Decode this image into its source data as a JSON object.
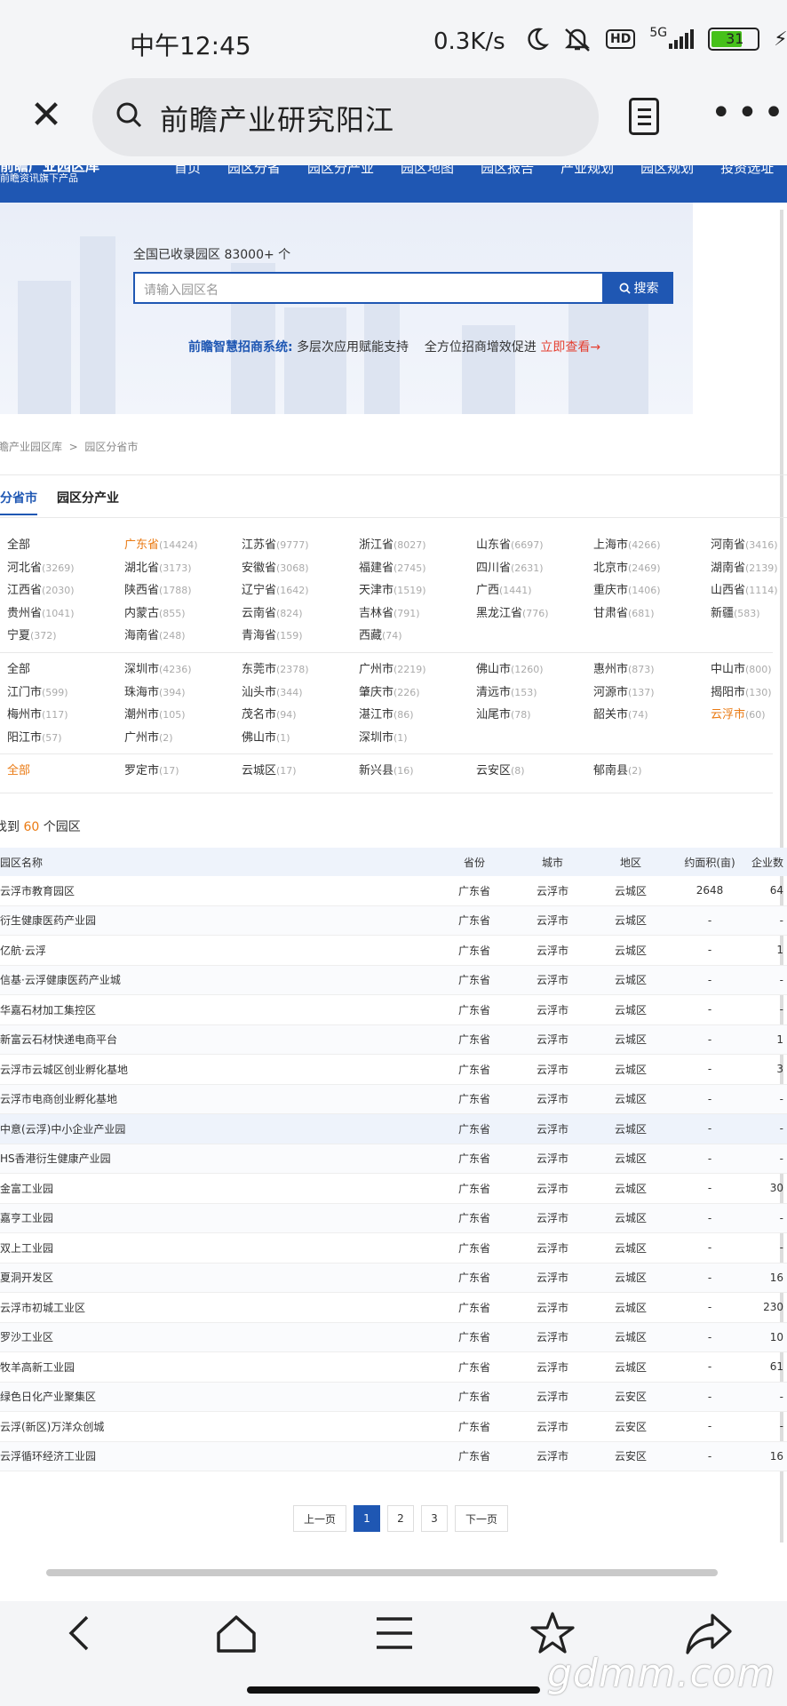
{
  "status": {
    "time": "中午12:45",
    "speed": "0.3K/s",
    "hd": "HD",
    "signal": "5G",
    "battery": "31"
  },
  "browser": {
    "query": "前瞻产业研究阳江"
  },
  "site": {
    "logo_line1": "前瞻产业园区库",
    "logo_line2": "前瞻资讯旗下产品",
    "menu": [
      "首页",
      "园区分省",
      "园区分产业",
      "园区地图",
      "园区报告",
      "产业规划",
      "园区规划",
      "投资选址"
    ],
    "hero": {
      "count": "全国已收录园区 83000+ 个",
      "placeholder": "请输入园区名",
      "search_label": "搜索",
      "promo_title": "前瞻智慧招商系统:",
      "promo_text": "多层次应用赋能支持    全方位招商增效促进",
      "promo_link": "立即查看→"
    },
    "breadcrumb": "前瞻产业园区库  >  园区分省市",
    "tabs": [
      "园区分省市",
      "园区分产业"
    ],
    "provinces": [
      {
        "name": "全部",
        "count": ""
      },
      {
        "name": "广东省",
        "count": "(14424)",
        "hl": true
      },
      {
        "name": "江苏省",
        "count": "(9777)"
      },
      {
        "name": "浙江省",
        "count": "(8027)"
      },
      {
        "name": "山东省",
        "count": "(6697)"
      },
      {
        "name": "上海市",
        "count": "(4266)"
      },
      {
        "name": "河南省",
        "count": "(3416)"
      },
      {
        "name": "河北省",
        "count": "(3269)"
      },
      {
        "name": "湖北省",
        "count": "(3173)"
      },
      {
        "name": "安徽省",
        "count": "(3068)"
      },
      {
        "name": "福建省",
        "count": "(2745)"
      },
      {
        "name": "四川省",
        "count": "(2631)"
      },
      {
        "name": "北京市",
        "count": "(2469)"
      },
      {
        "name": "湖南省",
        "count": "(2139)"
      },
      {
        "name": "江西省",
        "count": "(2030)"
      },
      {
        "name": "陕西省",
        "count": "(1788)"
      },
      {
        "name": "辽宁省",
        "count": "(1642)"
      },
      {
        "name": "天津市",
        "count": "(1519)"
      },
      {
        "name": "广西",
        "count": "(1441)"
      },
      {
        "name": "重庆市",
        "count": "(1406)"
      },
      {
        "name": "山西省",
        "count": "(1114)"
      },
      {
        "name": "贵州省",
        "count": "(1041)"
      },
      {
        "name": "内蒙古",
        "count": "(855)"
      },
      {
        "name": "云南省",
        "count": "(824)"
      },
      {
        "name": "吉林省",
        "count": "(791)"
      },
      {
        "name": "黑龙江省",
        "count": "(776)"
      },
      {
        "name": "甘肃省",
        "count": "(681)"
      },
      {
        "name": "新疆",
        "count": "(583)"
      },
      {
        "name": "宁夏",
        "count": "(372)"
      },
      {
        "name": "海南省",
        "count": "(248)"
      },
      {
        "name": "青海省",
        "count": "(159)"
      },
      {
        "name": "西藏",
        "count": "(74)"
      }
    ],
    "cities": [
      {
        "name": "全部",
        "count": ""
      },
      {
        "name": "深圳市",
        "count": "(4236)"
      },
      {
        "name": "东莞市",
        "count": "(2378)"
      },
      {
        "name": "广州市",
        "count": "(2219)"
      },
      {
        "name": "佛山市",
        "count": "(1260)"
      },
      {
        "name": "惠州市",
        "count": "(873)"
      },
      {
        "name": "中山市",
        "count": "(800)"
      },
      {
        "name": "江门市",
        "count": "(599)"
      },
      {
        "name": "珠海市",
        "count": "(394)"
      },
      {
        "name": "汕头市",
        "count": "(344)"
      },
      {
        "name": "肇庆市",
        "count": "(226)"
      },
      {
        "name": "清远市",
        "count": "(153)"
      },
      {
        "name": "河源市",
        "count": "(137)"
      },
      {
        "name": "揭阳市",
        "count": "(130)"
      },
      {
        "name": "梅州市",
        "count": "(117)"
      },
      {
        "name": "潮州市",
        "count": "(105)"
      },
      {
        "name": "茂名市",
        "count": "(94)"
      },
      {
        "name": "湛江市",
        "count": "(86)"
      },
      {
        "name": "汕尾市",
        "count": "(78)"
      },
      {
        "name": "韶关市",
        "count": "(74)"
      },
      {
        "name": "云浮市",
        "count": "(60)",
        "hl": true
      },
      {
        "name": "阳江市",
        "count": "(57)"
      },
      {
        "name": "广州市",
        "count": "(2)"
      },
      {
        "name": "佛山市",
        "count": "(1)"
      },
      {
        "name": "深圳市",
        "count": "(1)"
      }
    ],
    "districts": [
      {
        "name": "全部",
        "count": "",
        "hl": true
      },
      {
        "name": "罗定市",
        "count": "(17)"
      },
      {
        "name": "云城区",
        "count": "(17)"
      },
      {
        "name": "新兴县",
        "count": "(16)"
      },
      {
        "name": "云安区",
        "count": "(8)"
      },
      {
        "name": "郁南县",
        "count": "(2)"
      }
    ],
    "found_prefix": "找到 ",
    "found_count": "60",
    "found_suffix": " 个园区",
    "table_headers": [
      "园区名称",
      "省份",
      "城市",
      "地区",
      "约面积(亩)",
      "企业数"
    ],
    "rows": [
      [
        "云浮市教育园区",
        "广东省",
        "云浮市",
        "云城区",
        "2648",
        "64"
      ],
      [
        "衍生健康医药产业园",
        "广东省",
        "云浮市",
        "云城区",
        "-",
        "-"
      ],
      [
        "亿航·云浮",
        "广东省",
        "云浮市",
        "云城区",
        "-",
        "1"
      ],
      [
        "信基·云浮健康医药产业城",
        "广东省",
        "云浮市",
        "云城区",
        "-",
        "-"
      ],
      [
        "华嘉石材加工集控区",
        "广东省",
        "云浮市",
        "云城区",
        "-",
        "-"
      ],
      [
        "新富云石材快递电商平台",
        "广东省",
        "云浮市",
        "云城区",
        "-",
        "1"
      ],
      [
        "云浮市云城区创业孵化基地",
        "广东省",
        "云浮市",
        "云城区",
        "-",
        "3"
      ],
      [
        "云浮市电商创业孵化基地",
        "广东省",
        "云浮市",
        "云城区",
        "-",
        "-"
      ],
      [
        "中意(云浮)中小企业产业园",
        "广东省",
        "云浮市",
        "云城区",
        "-",
        "-"
      ],
      [
        "HS香港衍生健康产业园",
        "广东省",
        "云浮市",
        "云城区",
        "-",
        "-"
      ],
      [
        "金富工业园",
        "广东省",
        "云浮市",
        "云城区",
        "-",
        "30"
      ],
      [
        "嘉亨工业园",
        "广东省",
        "云浮市",
        "云城区",
        "-",
        "-"
      ],
      [
        "双上工业园",
        "广东省",
        "云浮市",
        "云城区",
        "-",
        "-"
      ],
      [
        "夏洞开发区",
        "广东省",
        "云浮市",
        "云城区",
        "-",
        "16"
      ],
      [
        "云浮市初城工业区",
        "广东省",
        "云浮市",
        "云城区",
        "-",
        "230"
      ],
      [
        "罗沙工业区",
        "广东省",
        "云浮市",
        "云城区",
        "-",
        "10"
      ],
      [
        "牧羊高新工业园",
        "广东省",
        "云浮市",
        "云城区",
        "-",
        "61"
      ],
      [
        "绿色日化产业聚集区",
        "广东省",
        "云浮市",
        "云安区",
        "-",
        "-"
      ],
      [
        "云浮(新区)万洋众创城",
        "广东省",
        "云浮市",
        "云安区",
        "-",
        "-"
      ],
      [
        "云浮循环经济工业园",
        "广东省",
        "云浮市",
        "云安区",
        "-",
        "16"
      ]
    ],
    "pager": {
      "prev": "上一页",
      "pages": [
        "1",
        "2",
        "3"
      ],
      "next": "下一页"
    }
  },
  "watermark": "gdmm.com",
  "colors": {
    "brand": "#1f57b3",
    "highlight": "#ea7a13",
    "promo_link": "#e53e2f"
  }
}
